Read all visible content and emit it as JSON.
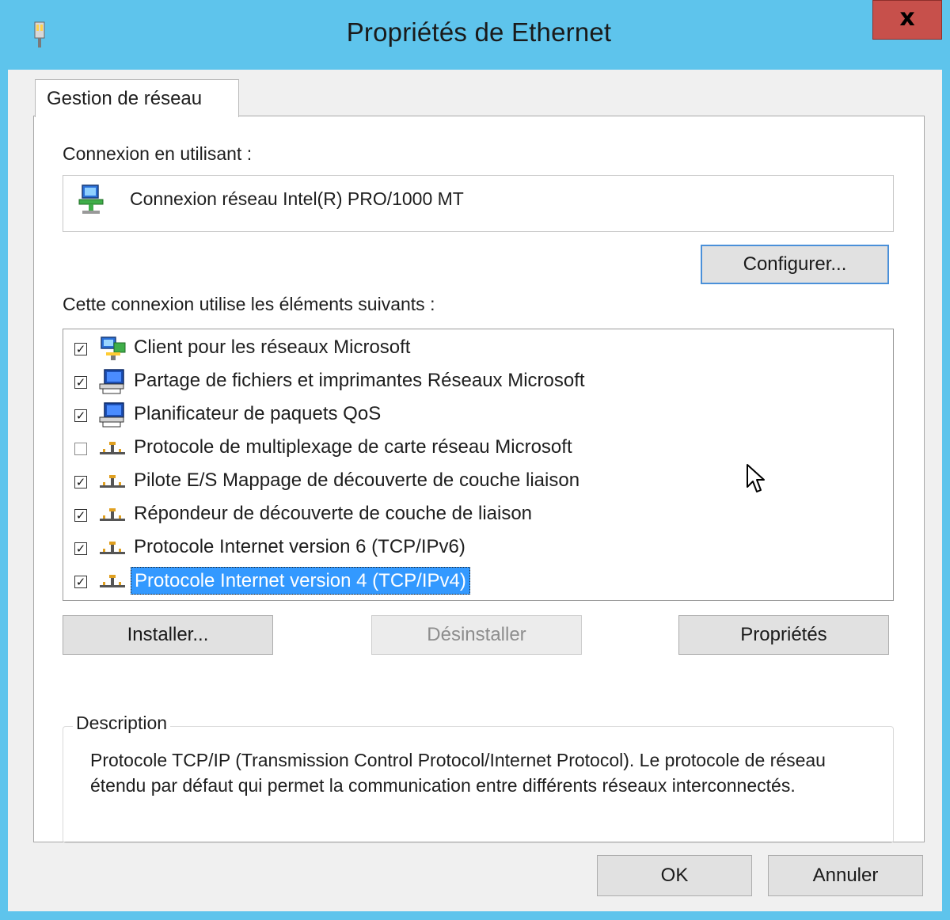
{
  "window": {
    "title": "Propriétés de Ethernet",
    "close_label": "x"
  },
  "tab": {
    "label": "Gestion de réseau"
  },
  "connection": {
    "label": "Connexion en utilisant :",
    "adapter_name": "Connexion réseau Intel(R) PRO/1000 MT",
    "configure_button": "Configurer..."
  },
  "components": {
    "label": "Cette connexion utilise les éléments suivants :",
    "items": [
      {
        "label": "Client pour les réseaux Microsoft",
        "checked": true,
        "icon": "network-client-icon"
      },
      {
        "label": "Partage de fichiers et imprimantes Réseaux Microsoft",
        "checked": true,
        "icon": "network-service-icon"
      },
      {
        "label": "Planificateur de paquets QoS",
        "checked": true,
        "icon": "network-service-icon"
      },
      {
        "label": "Protocole de multiplexage de carte réseau Microsoft",
        "checked": false,
        "icon": "protocol-icon"
      },
      {
        "label": "Pilote E/S Mappage de découverte de couche liaison",
        "checked": true,
        "icon": "protocol-icon"
      },
      {
        "label": "Répondeur de découverte de couche de liaison",
        "checked": true,
        "icon": "protocol-icon"
      },
      {
        "label": "Protocole Internet version 6 (TCP/IPv6)",
        "checked": true,
        "icon": "protocol-icon"
      },
      {
        "label": "Protocole Internet version 4 (TCP/IPv4)",
        "checked": true,
        "icon": "protocol-icon",
        "selected": true
      }
    ]
  },
  "buttons": {
    "install": "Installer...",
    "uninstall": "Désinstaller",
    "properties": "Propriétés",
    "ok": "OK",
    "cancel": "Annuler"
  },
  "description": {
    "legend": "Description",
    "text": "Protocole TCP/IP (Transmission Control Protocol/Internet Protocol). Le protocole de réseau étendu par défaut qui permet la communication entre différents réseaux interconnectés."
  },
  "colors": {
    "title_bar": "#5ec4ec",
    "close_button": "#c7504b",
    "selection": "#3399ff",
    "focus_border": "#4a90d9"
  }
}
